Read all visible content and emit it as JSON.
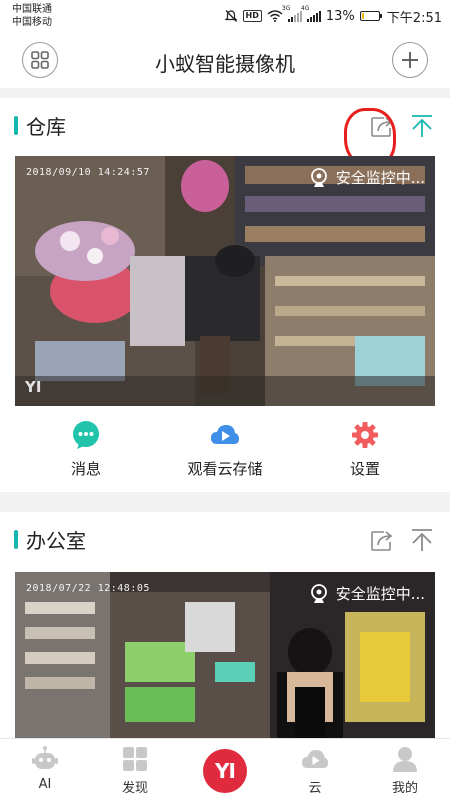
{
  "status_bar": {
    "carrier_1": "中国联通",
    "carrier_2": "中国移动",
    "hd": "HD",
    "net_1": "3G",
    "net_2": "4G",
    "battery": "13%",
    "battery_level": 0.13,
    "time": "下午2:51"
  },
  "header": {
    "title": "小蚁智能摄像机"
  },
  "cameras": [
    {
      "name": "仓库",
      "timestamp": "2018/09/10 14:24:57",
      "status": "安全监控中...",
      "watermark": "YI",
      "actions": [
        {
          "label": "消息",
          "icon": "message-icon",
          "color": "#21c3ab"
        },
        {
          "label": "观看云存储",
          "icon": "cloud-play-icon",
          "color": "#3f8fe8"
        },
        {
          "label": "设置",
          "icon": "settings-gear-icon",
          "color": "#f25c5c"
        }
      ]
    },
    {
      "name": "办公室",
      "timestamp": "2018/07/22 12:48:05",
      "status": "安全监控中..."
    }
  ],
  "tabs": [
    {
      "label": "AI",
      "icon": "robot-icon"
    },
    {
      "label": "发现",
      "icon": "discover-grid-icon"
    },
    {
      "label": "YI",
      "icon": "yi-logo"
    },
    {
      "label": "云",
      "icon": "cloud-play-icon"
    },
    {
      "label": "我的",
      "icon": "profile-icon"
    }
  ],
  "colors": {
    "accent": "#18b6b0",
    "logo_red": "#e02a3e",
    "annotation_red": "#e8201c"
  }
}
